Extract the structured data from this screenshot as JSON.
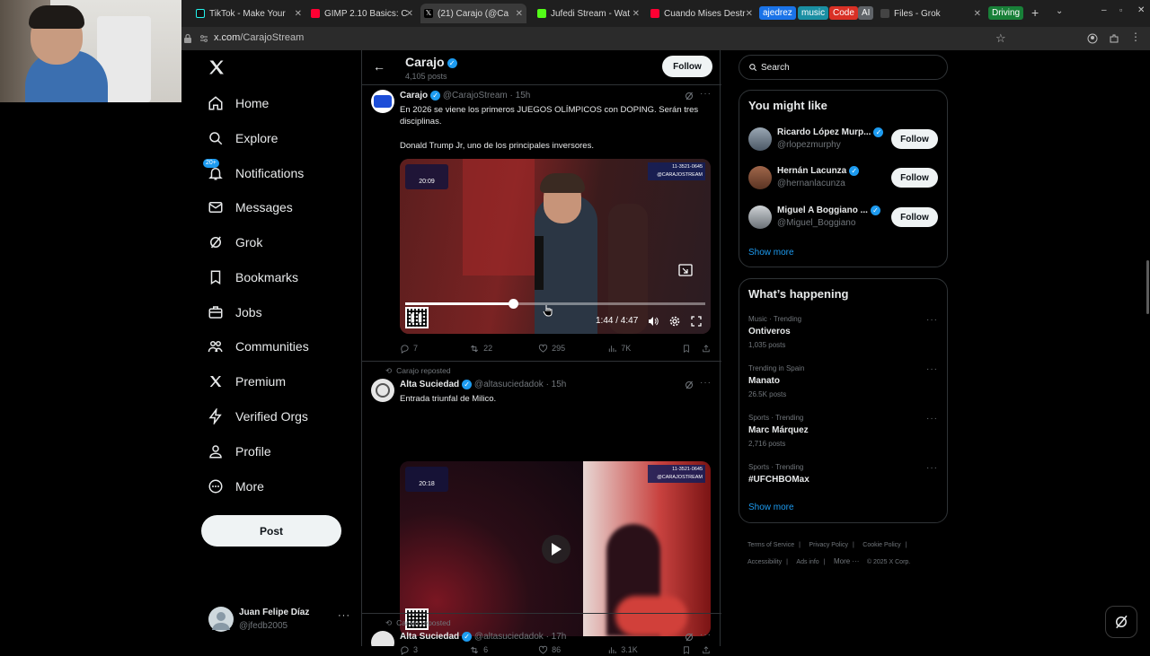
{
  "browser": {
    "tabs": [
      {
        "label": "TikTok - Make Your",
        "color": "#111111"
      },
      {
        "label": "GIMP 2.10 Basics: C",
        "color": "#e0245e"
      },
      {
        "label": "(21) Carajo (@Ca",
        "color": "#000000",
        "active": true
      },
      {
        "label": "Jufedi Stream - Wat",
        "color": "#53fc18"
      },
      {
        "label": "Cuando Mises Destr",
        "color": "#ff0033"
      },
      {
        "label": "Files - Grok",
        "color": "#444444"
      }
    ],
    "chips": [
      {
        "label": "ajedrez",
        "color": "#1a73e8"
      },
      {
        "label": "music",
        "color": "#1a8fa3"
      },
      {
        "label": "Code",
        "color": "#d93025"
      },
      {
        "label": "AI",
        "color": "#5f6368"
      },
      {
        "label": "Driving",
        "color": "#188038"
      }
    ],
    "url_host": "x.com",
    "url_path": "/CarajoStream"
  },
  "sidebar": {
    "items": [
      {
        "label": "Home",
        "icon": "home-icon"
      },
      {
        "label": "Explore",
        "icon": "search-icon"
      },
      {
        "label": "Notifications",
        "icon": "bell-icon",
        "badge": "20+"
      },
      {
        "label": "Messages",
        "icon": "mail-icon"
      },
      {
        "label": "Grok",
        "icon": "grok-icon"
      },
      {
        "label": "Bookmarks",
        "icon": "bookmark-icon"
      },
      {
        "label": "Jobs",
        "icon": "briefcase-icon"
      },
      {
        "label": "Communities",
        "icon": "people-icon"
      },
      {
        "label": "Premium",
        "icon": "x-logo-icon"
      },
      {
        "label": "Verified Orgs",
        "icon": "lightning-icon"
      },
      {
        "label": "Profile",
        "icon": "person-icon"
      },
      {
        "label": "More",
        "icon": "more-circle-icon"
      }
    ],
    "post_label": "Post",
    "account": {
      "name": "Juan Felipe Díaz",
      "handle": "@jfedb2005"
    }
  },
  "profile_header": {
    "name": "Carajo",
    "posts": "4,105 posts",
    "follow_label": "Follow"
  },
  "tweets": [
    {
      "author": "Carajo",
      "handle": "@CarajoStream",
      "time": "· 15h",
      "text1": "En 2026 se viene los primeros JUEGOS OLÍMPICOS con DOPING. Serán tres disciplinas.",
      "text2": "Donald Trump Jr, uno de los principales inversores.",
      "video": {
        "time": "1:44 / 4:47",
        "progress": 0.36,
        "overlay_time": "20:09",
        "overlay_tag": "@CARAJOSTREAM",
        "overlay_phone": "11-3521-0645"
      },
      "stats": {
        "replies": "7",
        "reposts": "22",
        "likes": "295",
        "views": "7K"
      }
    },
    {
      "reposted_by": "Carajo reposted",
      "author": "Alta Suciedad",
      "handle": "@altasuciedadok",
      "time": "· 15h",
      "text1": "Entrada triunfal de Milico.",
      "video": {
        "overlay_time": "20:18",
        "overlay_tag": "@CARAJOSTREAM",
        "overlay_phone": "11-3521-0645"
      },
      "stats": {
        "replies": "3",
        "reposts": "6",
        "likes": "86",
        "views": "3.1K"
      }
    },
    {
      "reposted_by": "Carajo reposted",
      "author": "Alta Suciedad",
      "handle": "@altasuciedadok",
      "time": "· 17h"
    }
  ],
  "search": {
    "placeholder": "Search"
  },
  "you_might_like": {
    "title": "You might like",
    "users": [
      {
        "name": "Ricardo López Murp...",
        "handle": "@rlopezmurphy",
        "follow": "Follow"
      },
      {
        "name": "Hernán Lacunza",
        "handle": "@hernanlacunza",
        "follow": "Follow"
      },
      {
        "name": "Miguel A Boggiano ...",
        "handle": "@Miguel_Boggiano",
        "follow": "Follow"
      }
    ],
    "show_more": "Show more"
  },
  "whats_happening": {
    "title": "What’s happening",
    "trends": [
      {
        "meta": "Music · Trending",
        "name": "Ontiveros",
        "count": "1,035 posts"
      },
      {
        "meta": "Trending in Spain",
        "name": "Manato",
        "count": "26.5K posts"
      },
      {
        "meta": "Sports · Trending",
        "name": "Marc Márquez",
        "count": "2,716 posts"
      },
      {
        "meta": "Sports · Trending",
        "name": "#UFCHBOMax",
        "count": ""
      }
    ],
    "show_more": "Show more"
  },
  "footer": {
    "links": [
      "Terms of Service",
      "Privacy Policy",
      "Cookie Policy",
      "Accessibility",
      "Ads info",
      "More ···",
      "© 2025 X Corp."
    ]
  }
}
